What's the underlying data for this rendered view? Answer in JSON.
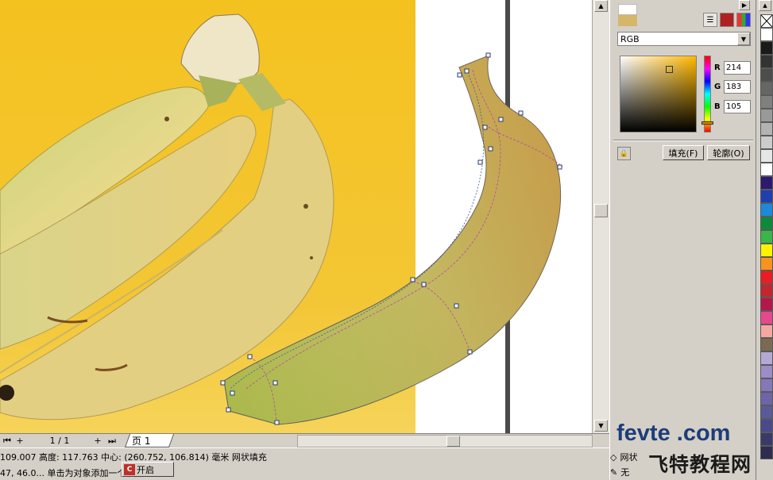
{
  "canvas": {
    "photo_alt": "banana bunch photo",
    "background": "#ffffff",
    "photo_bg": "#f2bf1e"
  },
  "pagebar": {
    "first": "⏮",
    "prev_add": "+",
    "page_counter": "1 / 1",
    "next_add": "+",
    "last": "⏭",
    "page_tab": "页 1"
  },
  "status": {
    "line1": "109.007  高度: 117.763  中心: (260.752, 106.814)  毫米        网状填充",
    "line2": "47, 46.0...  单击为对象添加一个节点",
    "task_label": "开启"
  },
  "docker": {
    "color_model": "RGB",
    "r_label": "R",
    "r_value": "214",
    "g_label": "G",
    "g_value": "183",
    "b_label": "B",
    "b_value": "105",
    "fill_tab": "填充(F)",
    "outline_tab": "轮廓(O)",
    "current_color": "#d6b769",
    "brand_en": "fevte .com",
    "brand_cn": "飞特教程网",
    "fill_indicator": "网状",
    "outline_indicator": "无"
  },
  "palette": {
    "colors": [
      "#ffffff",
      "#1a1a1a",
      "#333333",
      "#4d4d4d",
      "#666666",
      "#808080",
      "#999999",
      "#b3b3b3",
      "#cccccc",
      "#e6e6e6",
      "#ffffff",
      "#2d1a70",
      "#1f3fae",
      "#1c89d9",
      "#0b8a3a",
      "#39b54a",
      "#fff200",
      "#f7941d",
      "#ed1c24",
      "#c1272d",
      "#b5174b",
      "#e6488c",
      "#f4a6a0",
      "#7a6a50",
      "#b4a8d8",
      "#9c8cc8",
      "#8478b8",
      "#6e64a8",
      "#5a5a9a",
      "#4a4a8a",
      "#3a3a6a",
      "#2d2d4d"
    ]
  }
}
